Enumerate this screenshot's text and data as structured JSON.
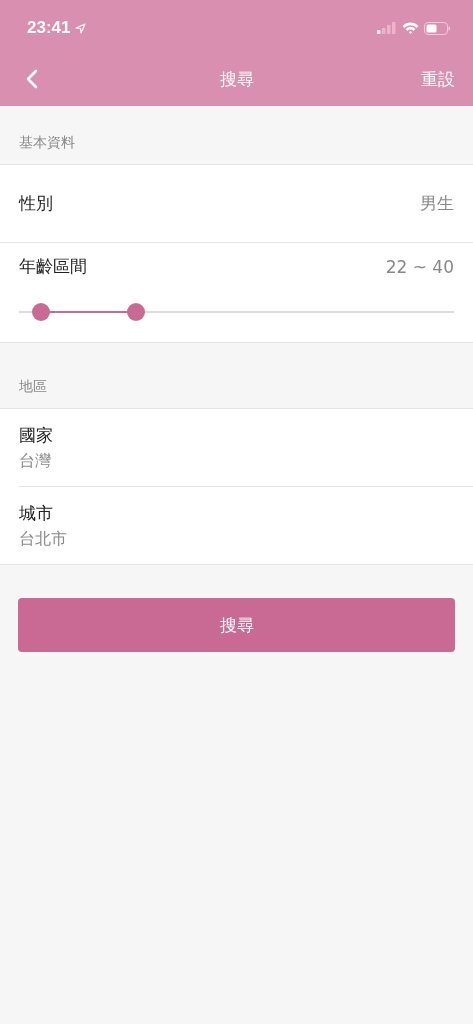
{
  "status_bar": {
    "time": "23:41"
  },
  "nav": {
    "title": "搜尋",
    "action": "重設"
  },
  "basic": {
    "header": "基本資料",
    "gender": {
      "label": "性別",
      "value": "男生"
    },
    "age": {
      "label": "年齡區間",
      "reading": "22 ~ 40",
      "thumbs": [
        {
          "level": 0.05
        },
        {
          "level": 0.27
        }
      ]
    }
  },
  "region": {
    "header": "地區",
    "rows": [
      {
        "label": "國家",
        "value": "台灣"
      },
      {
        "label": "城市",
        "value": "台北市"
      }
    ]
  },
  "search_button": "搜尋"
}
